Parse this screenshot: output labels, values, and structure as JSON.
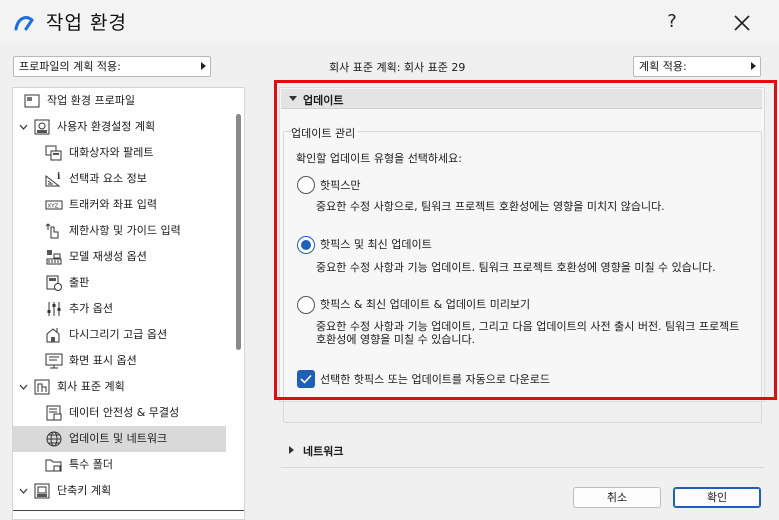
{
  "window": {
    "title": "작업 환경",
    "help": "?"
  },
  "toolbar": {
    "profile_select": "프로파일의 계획 적용:",
    "scheme_label": "회사 표준 계획: 회사 표준 29",
    "apply_select": "계획 적용:"
  },
  "tree": {
    "items": [
      {
        "label": "작업 환경 프로파일",
        "icon": "profile-icon"
      },
      {
        "label": "사용자 환경설정 계획",
        "icon": "user-scheme-icon"
      },
      {
        "label": "대화상자와 팔레트",
        "icon": "dialogs-icon"
      },
      {
        "label": "선택과 요소 정보",
        "icon": "selection-icon"
      },
      {
        "label": "트래커와 좌표 입력",
        "icon": "tracker-icon"
      },
      {
        "label": "제한사항 및 가이드 입력",
        "icon": "constraints-icon"
      },
      {
        "label": "모델 재생성 옵션",
        "icon": "model-icon"
      },
      {
        "label": "출판",
        "icon": "publish-icon"
      },
      {
        "label": "추가 옵션",
        "icon": "more-options-icon"
      },
      {
        "label": "다시그리기 고급 옵션",
        "icon": "redraw-icon"
      },
      {
        "label": "화면 표시 옵션",
        "icon": "display-icon"
      },
      {
        "label": "회사 표준 계획",
        "icon": "company-scheme-icon"
      },
      {
        "label": "데이터 안전성 & 무결성",
        "icon": "data-safety-icon"
      },
      {
        "label": "업데이트 및 네트워크",
        "icon": "globe-icon"
      },
      {
        "label": "특수 폴더",
        "icon": "folder-icon"
      },
      {
        "label": "단축키 계획",
        "icon": "shortcut-scheme-icon"
      }
    ]
  },
  "update_section": {
    "header": "업데이트",
    "group_label": "업데이트 관리",
    "prompt": "확인할 업데이트 유형을 선택하세요:",
    "options": [
      {
        "title": "핫픽스만",
        "desc": "중요한 수정 사항으로, 팀워크 프로젝트 호환성에는 영향을 미치지 않습니다.",
        "selected": false
      },
      {
        "title": "핫픽스 및 최신 업데이트",
        "desc": "중요한 수정 사항과 기능 업데이트. 팀워크 프로젝트 호환성에 영향을 미칠 수 있습니다.",
        "selected": true
      },
      {
        "title": "핫픽스 & 최신 업데이트 & 업데이트 미리보기",
        "desc": "중요한 수정 사항과 기능 업데이트, 그리고 다음 업데이트의 사전 출시 버전. 팀워크 프로젝트 호환성에 영향을 미칠 수 있습니다.",
        "selected": false
      }
    ],
    "auto_download": {
      "label": "선택한 핫픽스 또는 업데이트를 자동으로 다운로드",
      "checked": true
    }
  },
  "network_section": {
    "header": "네트워크"
  },
  "buttons": {
    "cancel": "취소",
    "ok": "확인"
  },
  "colors": {
    "accent": "#1f5fb5",
    "highlight": "#e20c0c"
  }
}
